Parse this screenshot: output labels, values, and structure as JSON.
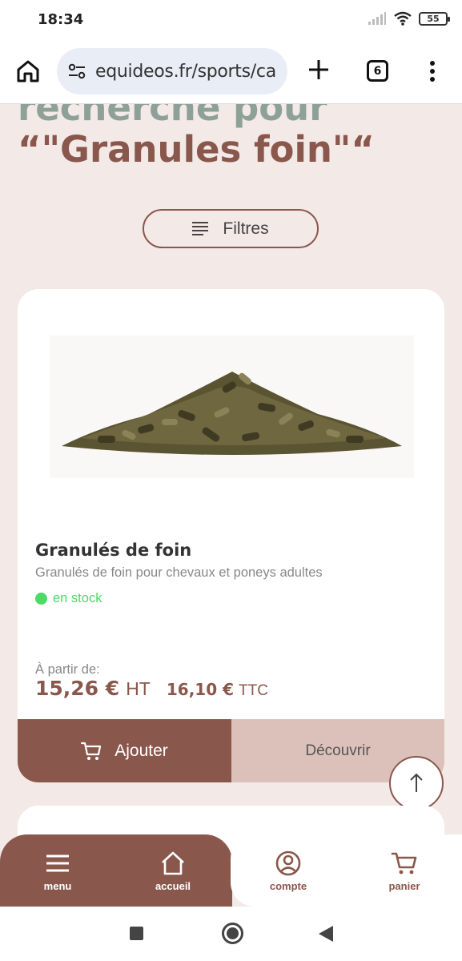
{
  "status_bar": {
    "time": "18:34",
    "battery": "55"
  },
  "browser": {
    "url": "equideos.fr/sports/ca",
    "tab_count": "6"
  },
  "heading": {
    "line1": "recherche pour",
    "line2": "“\"Granules foin\"“"
  },
  "filters": {
    "label": "Filtres"
  },
  "product": {
    "name": "Granulés de foin",
    "description": "Granulés de foin pour chevaux et poneys adultes",
    "stock": "en stock",
    "price_from": "À partir de:",
    "price_ht": "15,26 €",
    "unit_ht": "HT",
    "price_ttc": "16,10 €",
    "unit_ttc": "TTC",
    "add_label": "Ajouter",
    "discover_label": "Découvrir"
  },
  "bottom_nav": {
    "items": [
      {
        "label": "menu",
        "icon": "menu-icon"
      },
      {
        "label": "accueil",
        "icon": "home-icon"
      },
      {
        "label": "compte",
        "icon": "account-icon"
      },
      {
        "label": "panier",
        "icon": "cart-icon"
      }
    ]
  },
  "colors": {
    "brand": "#8a574c",
    "brand_light": "#dcc1bb",
    "background": "#f3e9e7",
    "stock_green": "#4cd964",
    "heading_faded": "#8ea199"
  }
}
